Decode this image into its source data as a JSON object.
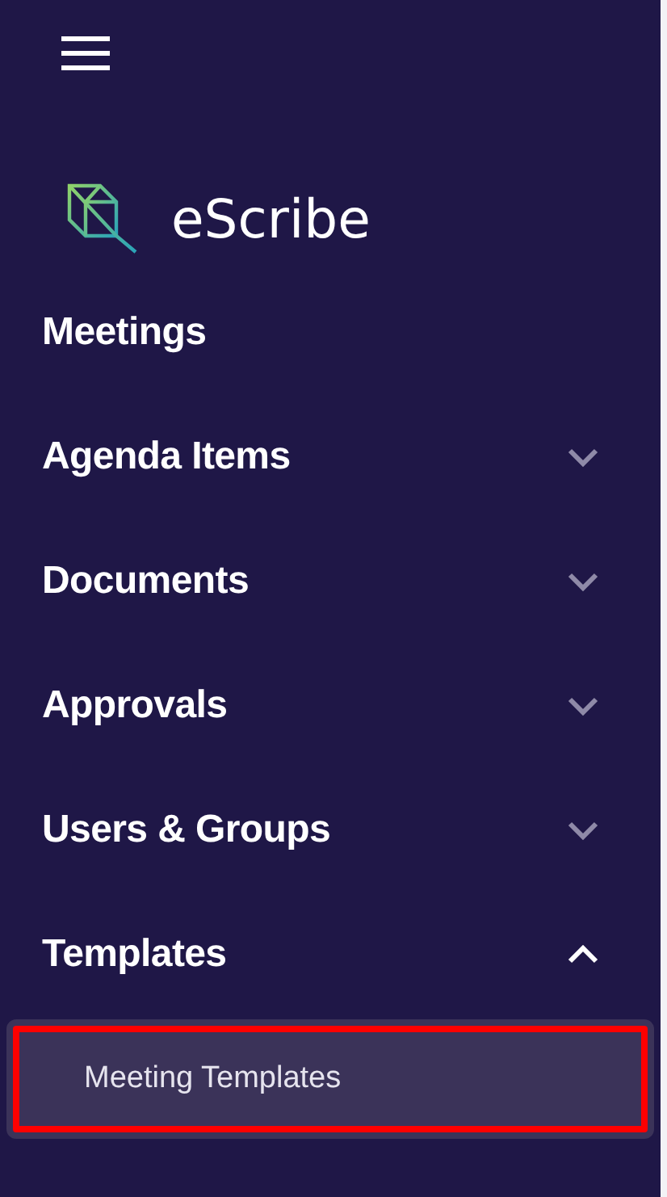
{
  "brand": {
    "name": "eScribe"
  },
  "nav": [
    {
      "label": "Meetings",
      "kind": "link"
    },
    {
      "label": "Agenda Items",
      "kind": "group",
      "expanded": false
    },
    {
      "label": "Documents",
      "kind": "group",
      "expanded": false
    },
    {
      "label": "Approvals",
      "kind": "group",
      "expanded": false
    },
    {
      "label": "Users & Groups",
      "kind": "group",
      "expanded": false
    },
    {
      "label": "Templates",
      "kind": "group",
      "expanded": true,
      "children": [
        {
          "label": "Meeting Templates",
          "selected": true,
          "highlighted": true
        }
      ]
    }
  ]
}
